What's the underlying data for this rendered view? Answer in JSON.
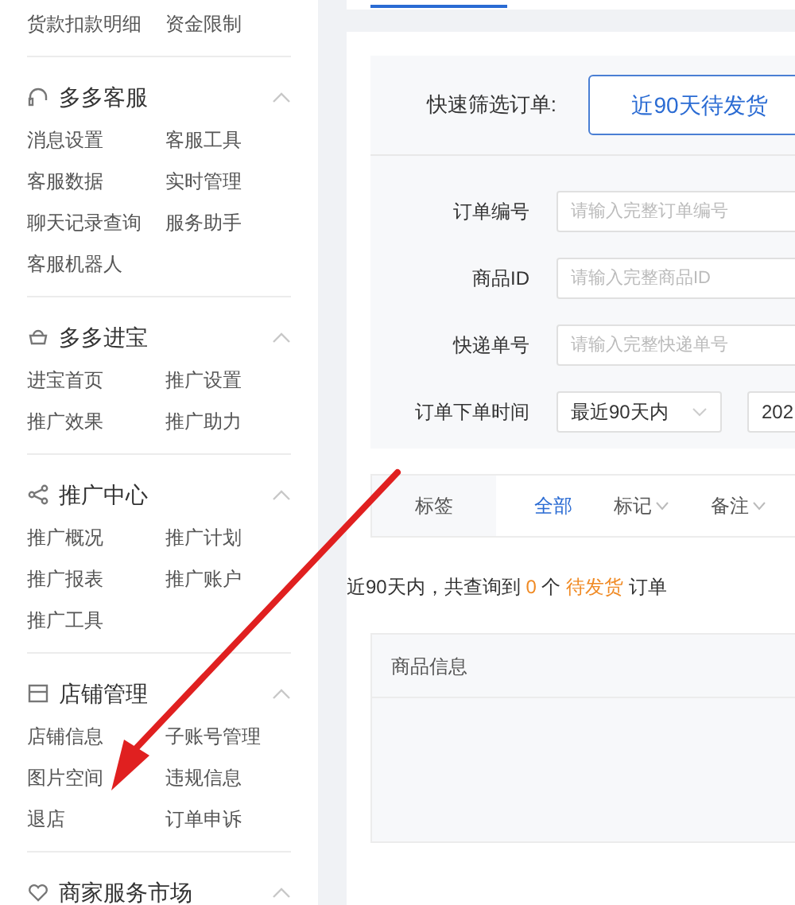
{
  "sidebar": {
    "sections": [
      {
        "items": [
          "货款扣款明细",
          "资金限制"
        ]
      },
      {
        "title": "多多客服",
        "expanded": true,
        "items": [
          "消息设置",
          "客服工具",
          "客服数据",
          "实时管理",
          "聊天记录查询",
          "服务助手",
          "客服机器人"
        ]
      },
      {
        "title": "多多进宝",
        "expanded": true,
        "items": [
          "进宝首页",
          "推广设置",
          "推广效果",
          "推广助力"
        ]
      },
      {
        "title": "推广中心",
        "expanded": true,
        "items": [
          "推广概况",
          "推广计划",
          "推广报表",
          "推广账户",
          "推广工具"
        ]
      },
      {
        "title": "店铺管理",
        "expanded": true,
        "items": [
          "店铺信息",
          "子账号管理",
          "图片空间",
          "违规信息",
          "退店",
          "订单申诉"
        ]
      },
      {
        "title": "商家服务市场",
        "expanded": true
      }
    ]
  },
  "quick_filter": {
    "label": "快速筛选订单:",
    "button": "近90天待发货"
  },
  "fields": [
    {
      "kind": "input",
      "label": "订单编号",
      "placeholder": "请输入完整订单编号"
    },
    {
      "kind": "input",
      "label": "商品ID",
      "placeholder": "请输入完整商品ID"
    },
    {
      "kind": "input",
      "label": "快递单号",
      "placeholder": "请输入完整快递单号"
    },
    {
      "kind": "date",
      "label": "订单下单时间",
      "select": "最近90天内",
      "value": "202"
    }
  ],
  "tag_bar": {
    "label": "标签",
    "tabs": [
      {
        "label": "全部",
        "selected": true,
        "dropdown": false
      },
      {
        "label": "标记",
        "selected": false,
        "dropdown": true
      },
      {
        "label": "备注",
        "selected": false,
        "dropdown": true
      }
    ]
  },
  "summary": "近90天内，共查询到 **0** 个 **待发货** 订单",
  "table": {
    "columns": [
      "商品信息"
    ]
  }
}
